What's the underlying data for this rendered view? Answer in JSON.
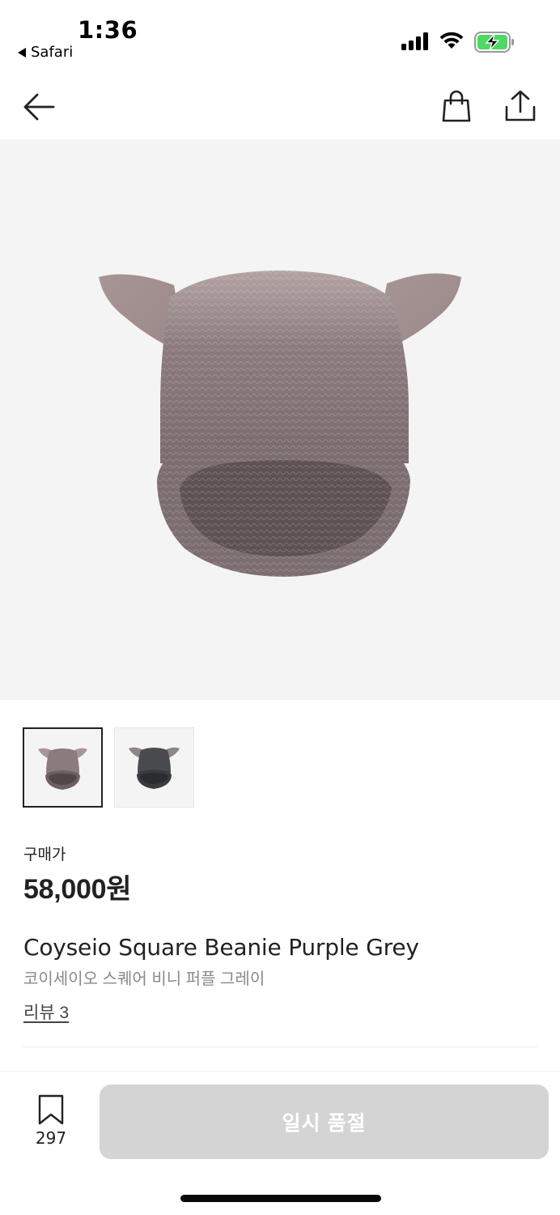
{
  "status_bar": {
    "time": "1:36",
    "back_app": "Safari"
  },
  "thumbnails": [
    {
      "alt": "purple grey beanie",
      "active": true
    },
    {
      "alt": "charcoal beanie",
      "active": false
    }
  ],
  "product": {
    "price_label": "구매가",
    "price": "58,000원",
    "title_en": "Coyseio Square Beanie Purple Grey",
    "title_ko": "코이세이오 스퀘어 비니 퍼플 그레이",
    "review_link": "리뷰 3"
  },
  "bottom_bar": {
    "bookmark_count": "297",
    "soldout_label": "일시 품절"
  },
  "colors": {
    "hero_bg": "#f4f4f4",
    "button_disabled": "#d4d4d4",
    "battery_green": "#4cd964",
    "beanie_purple_grey": "#7a6c6e",
    "beanie_charcoal": "#3f4145"
  }
}
